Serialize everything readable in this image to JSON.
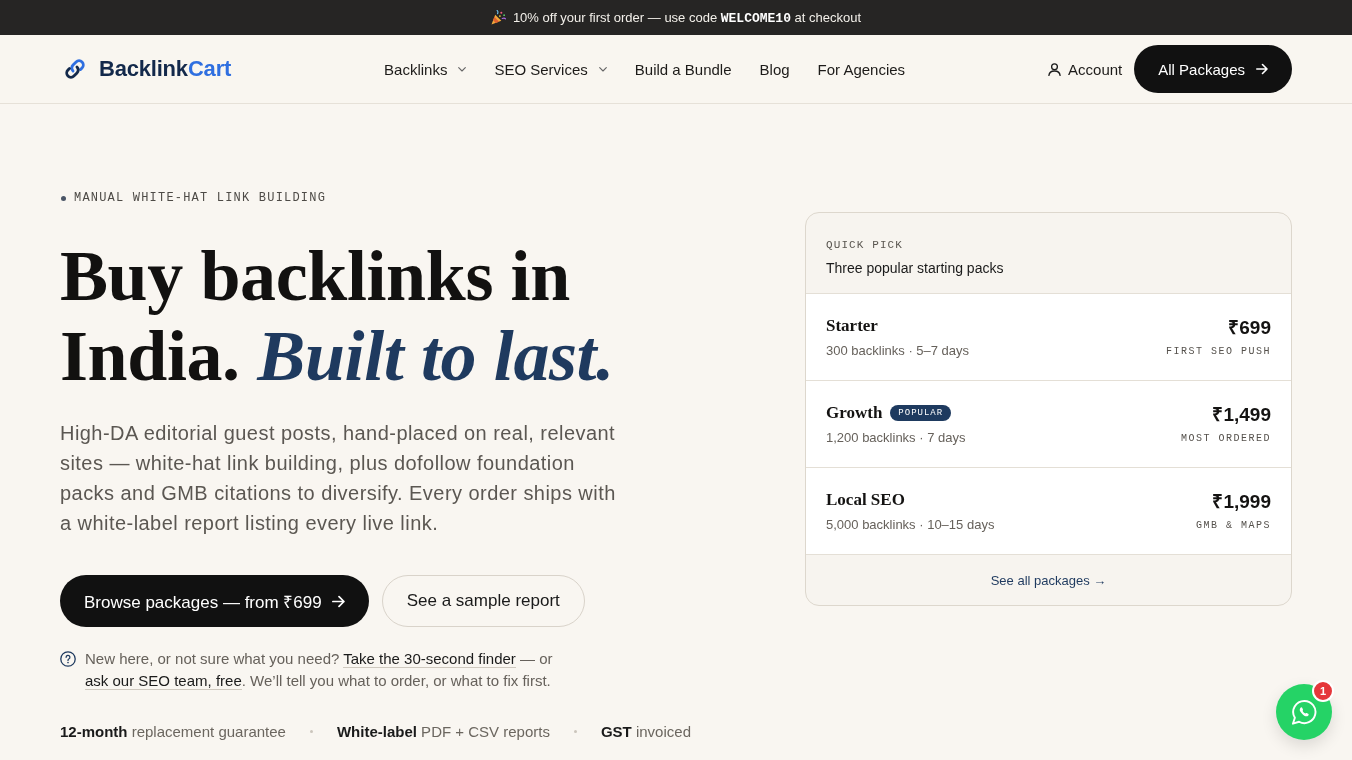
{
  "announcement": {
    "text": "10% off your first order — use code **WELCOME10** at checkout"
  },
  "header": {
    "logo": {
      "primary": "Backlink",
      "accent": "Cart"
    },
    "nav": [
      {
        "label": "Backlinks",
        "has_menu": true
      },
      {
        "label": "SEO Services",
        "has_menu": true
      },
      {
        "label": "Build a Bundle",
        "has_menu": false
      },
      {
        "label": "Blog",
        "has_menu": false
      },
      {
        "label": "For Agencies",
        "has_menu": false
      }
    ],
    "account": "Account",
    "cta": "All Packages"
  },
  "hero": {
    "eyebrow": "MANUAL WHITE-HAT LINK BUILDING",
    "headline": "Buy backlinks in India. *Built to last.*",
    "intro": "High-DA editorial guest posts, hand-placed on real, relevant sites — white-hat link building, plus dofollow foundation packs and GMB citations to diversify. Every order ships with a white-label report listing every live link.",
    "buttons": [
      {
        "label": "Browse packages — from ₹699",
        "kind": "primary",
        "arrow": true
      },
      {
        "label": "See a sample report",
        "kind": "secondary",
        "arrow": false
      }
    ],
    "help": [
      {
        "kind": "text",
        "text": "New here, or not sure what you need? "
      },
      {
        "kind": "link",
        "text": "Take the 30-second finder"
      },
      {
        "kind": "text",
        "text": " — or "
      },
      {
        "kind": "link",
        "text": "ask our SEO team, free"
      },
      {
        "kind": "text",
        "text": ". We’ll tell you what to order, or what to fix first."
      }
    ],
    "trust": [
      "**12-month** replacement guarantee",
      "**White-label** PDF + CSV reports",
      "**GST** invoiced"
    ]
  },
  "quick_pick": {
    "eyebrow": "QUICK PICK",
    "title": "Three popular starting packs",
    "packages": [
      {
        "name": "Starter",
        "details": "300 backlinks · 5–7 days",
        "price": "₹699",
        "note": "FIRST SEO PUSH"
      },
      {
        "name": "Growth",
        "tag": "POPULAR",
        "details": "1,200 backlinks · 7 days",
        "price": "₹1,499",
        "note": "MOST ORDERED"
      },
      {
        "name": "Local SEO",
        "details": "5,000 backlinks · 10–15 days",
        "price": "₹1,999",
        "note": "GMB & MAPS"
      }
    ],
    "footer_link": "See all packages →"
  },
  "chat": {
    "count": "1"
  }
}
